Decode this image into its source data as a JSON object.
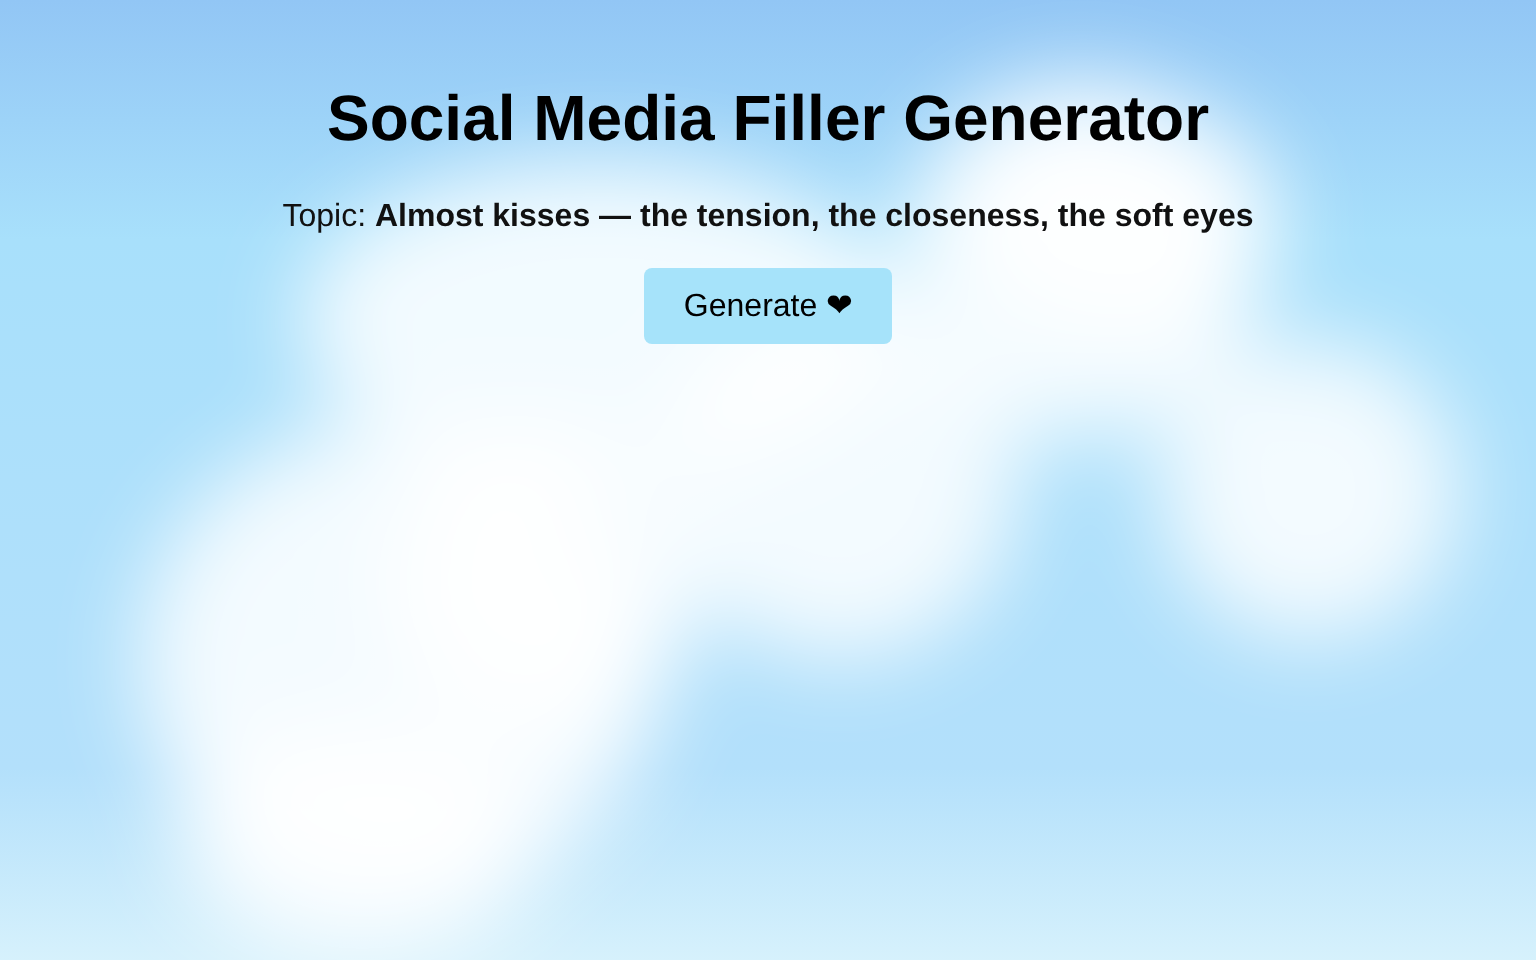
{
  "title": "Social Media Filler Generator",
  "topic": "Topic: **Almost kisses — the tension, the closeness, the soft eyes**",
  "button": {
    "label": "Generate ❤"
  }
}
